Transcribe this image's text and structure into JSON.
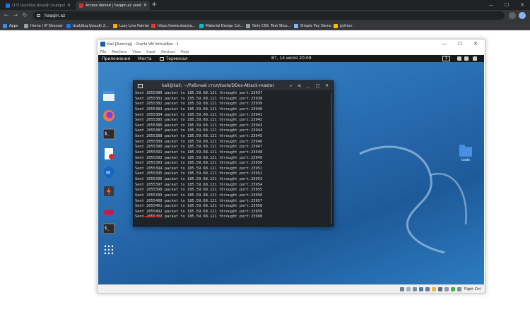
{
  "browser": {
    "tabs": [
      {
        "title": "(17) Աանձնգ Արամի Հարցանումը",
        "active": false,
        "favicon_color": "#1877f2"
      },
      {
        "title": "Access denied | haqqin.az used C",
        "active": true,
        "favicon_color": "#d93025"
      }
    ],
    "new_tab": "+",
    "window_controls": [
      "—",
      "☐",
      "✕"
    ],
    "url": "haqqin.az",
    "bookmarks": [
      {
        "label": "Apps",
        "color": "#4285f4"
      },
      {
        "label": "Home | IP Stresser",
        "color": "#9aa0a6"
      },
      {
        "label": "Աանձնգ Արամի 2...",
        "color": "#1877f2"
      },
      {
        "label": "Lazy Line Painter",
        "color": "#ffb000"
      },
      {
        "label": "https://www.starpla...",
        "color": "#e53935"
      },
      {
        "label": "Material Design Col...",
        "color": "#00bcd4"
      },
      {
        "label": "Only CSS: Text Slice...",
        "color": "#9aa0a6"
      },
      {
        "label": "Simple Pay Demo",
        "color": "#8ab4f8"
      },
      {
        "label": "python",
        "color": "#fbbc04"
      }
    ]
  },
  "vbox": {
    "title": "Kali [Running] - Oracle VM VirtualBox : 1",
    "menu": [
      "File",
      "Machine",
      "View",
      "Input",
      "Devices",
      "Help"
    ],
    "controls": [
      "—",
      "☐",
      "✕"
    ],
    "host_key": "Right Ctrl"
  },
  "kali": {
    "menu_apps": "Приложения",
    "menu_places": "Места",
    "menu_terminal": "Терминал",
    "clock": "Вт, 14 июля  20:09",
    "workspace": "1",
    "desktop_folder": "tools"
  },
  "terminal": {
    "title": "kali@kali: ~/Рабочий стол/tools/DDos-Attack-master",
    "ip": "185.59.68.121",
    "lines": [
      {
        "packet": "2055380",
        "port": "23937"
      },
      {
        "packet": "2055381",
        "port": "23938"
      },
      {
        "packet": "2055382",
        "port": "23939"
      },
      {
        "packet": "2055383",
        "port": "23940"
      },
      {
        "packet": "2055384",
        "port": "23941"
      },
      {
        "packet": "2055385",
        "port": "23942"
      },
      {
        "packet": "2055386",
        "port": "23943"
      },
      {
        "packet": "2055387",
        "port": "23944"
      },
      {
        "packet": "2055388",
        "port": "23945"
      },
      {
        "packet": "2055389",
        "port": "23946"
      },
      {
        "packet": "2055390",
        "port": "23947"
      },
      {
        "packet": "2055391",
        "port": "23948"
      },
      {
        "packet": "2055392",
        "port": "23949"
      },
      {
        "packet": "2055393",
        "port": "23950"
      },
      {
        "packet": "2055394",
        "port": "23951"
      },
      {
        "packet": "2055395",
        "port": "23952"
      },
      {
        "packet": "2055396",
        "port": "23953"
      },
      {
        "packet": "2055397",
        "port": "23954"
      },
      {
        "packet": "2055398",
        "port": "23955"
      },
      {
        "packet": "2055399",
        "port": "23956"
      },
      {
        "packet": "2055400",
        "port": "23957"
      },
      {
        "packet": "2055401",
        "port": "23958"
      },
      {
        "packet": "2055402",
        "port": "23959"
      },
      {
        "packet": "2055403",
        "port": "23960"
      }
    ]
  }
}
